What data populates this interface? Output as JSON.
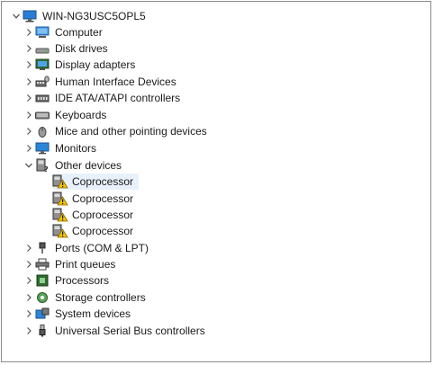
{
  "root": {
    "label": "WIN-NG3USC5OPL5",
    "icon": "computer-root-icon"
  },
  "categories_before": [
    {
      "label": "Computer",
      "icon": "computer-icon"
    },
    {
      "label": "Disk drives",
      "icon": "disk-drive-icon"
    },
    {
      "label": "Display adapters",
      "icon": "display-adapter-icon"
    },
    {
      "label": "Human Interface Devices",
      "icon": "hid-icon"
    },
    {
      "label": "IDE ATA/ATAPI controllers",
      "icon": "ide-controller-icon"
    },
    {
      "label": "Keyboards",
      "icon": "keyboard-icon"
    },
    {
      "label": "Mice and other pointing devices",
      "icon": "mouse-icon"
    },
    {
      "label": "Monitors",
      "icon": "monitor-icon"
    }
  ],
  "other_devices": {
    "label": "Other devices",
    "icon": "other-devices-icon",
    "children": [
      {
        "label": "Coprocessor",
        "icon": "warning-device-icon"
      },
      {
        "label": "Coprocessor",
        "icon": "warning-device-icon"
      },
      {
        "label": "Coprocessor",
        "icon": "warning-device-icon"
      },
      {
        "label": "Coprocessor",
        "icon": "warning-device-icon"
      }
    ]
  },
  "categories_after": [
    {
      "label": "Ports (COM & LPT)",
      "icon": "port-icon"
    },
    {
      "label": "Print queues",
      "icon": "printer-icon"
    },
    {
      "label": "Processors",
      "icon": "processor-icon"
    },
    {
      "label": "Storage controllers",
      "icon": "storage-controller-icon"
    },
    {
      "label": "System devices",
      "icon": "system-devices-icon"
    },
    {
      "label": "Universal Serial Bus controllers",
      "icon": "usb-icon"
    }
  ]
}
